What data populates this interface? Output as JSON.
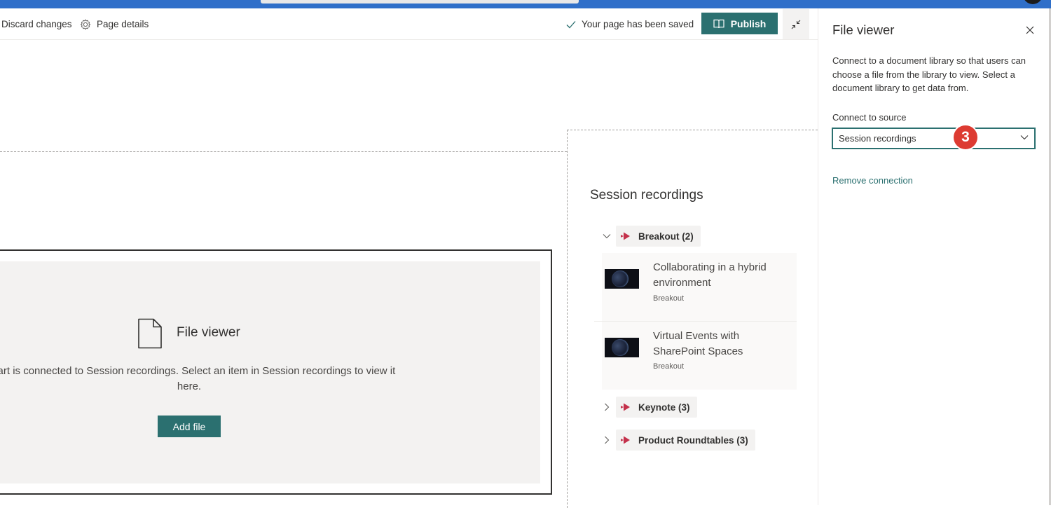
{
  "command_bar": {
    "discard_label": "Discard changes",
    "details_label": "Page details",
    "saved_status": "Your page has been saved",
    "publish_label": "Publish"
  },
  "file_viewer_part": {
    "title": "File viewer",
    "message": "b part is connected to Session recordings. Select an item in Session recordings to view it here.",
    "add_file_label": "Add file"
  },
  "session_recordings": {
    "title": "Session recordings",
    "groups": [
      {
        "label": "Breakout (2)",
        "expanded": true
      },
      {
        "label": "Keynote (3)",
        "expanded": false
      },
      {
        "label": "Product Roundtables (3)",
        "expanded": false
      }
    ],
    "items": [
      {
        "title": "Collaborating in a hybrid environment",
        "category": "Breakout"
      },
      {
        "title": "Virtual Events with SharePoint Spaces",
        "category": "Breakout"
      }
    ]
  },
  "panel": {
    "title": "File viewer",
    "description": "Connect to a document library so that users can choose a file from the library to view. Select a document library to get data from.",
    "source_label": "Connect to source",
    "source_value": "Session recordings",
    "step_badge": "3",
    "remove_label": "Remove connection"
  },
  "colors": {
    "accent": "#2b7070",
    "topbar": "#2f6fc9",
    "badge": "#dd3b32",
    "group_icon": "#c4314b"
  },
  "icons": [
    "gear-icon",
    "checkmark-icon",
    "book-icon",
    "collapse-icon",
    "document-icon",
    "chevron-down-icon",
    "chevron-right-icon",
    "stream-icon",
    "close-icon"
  ]
}
